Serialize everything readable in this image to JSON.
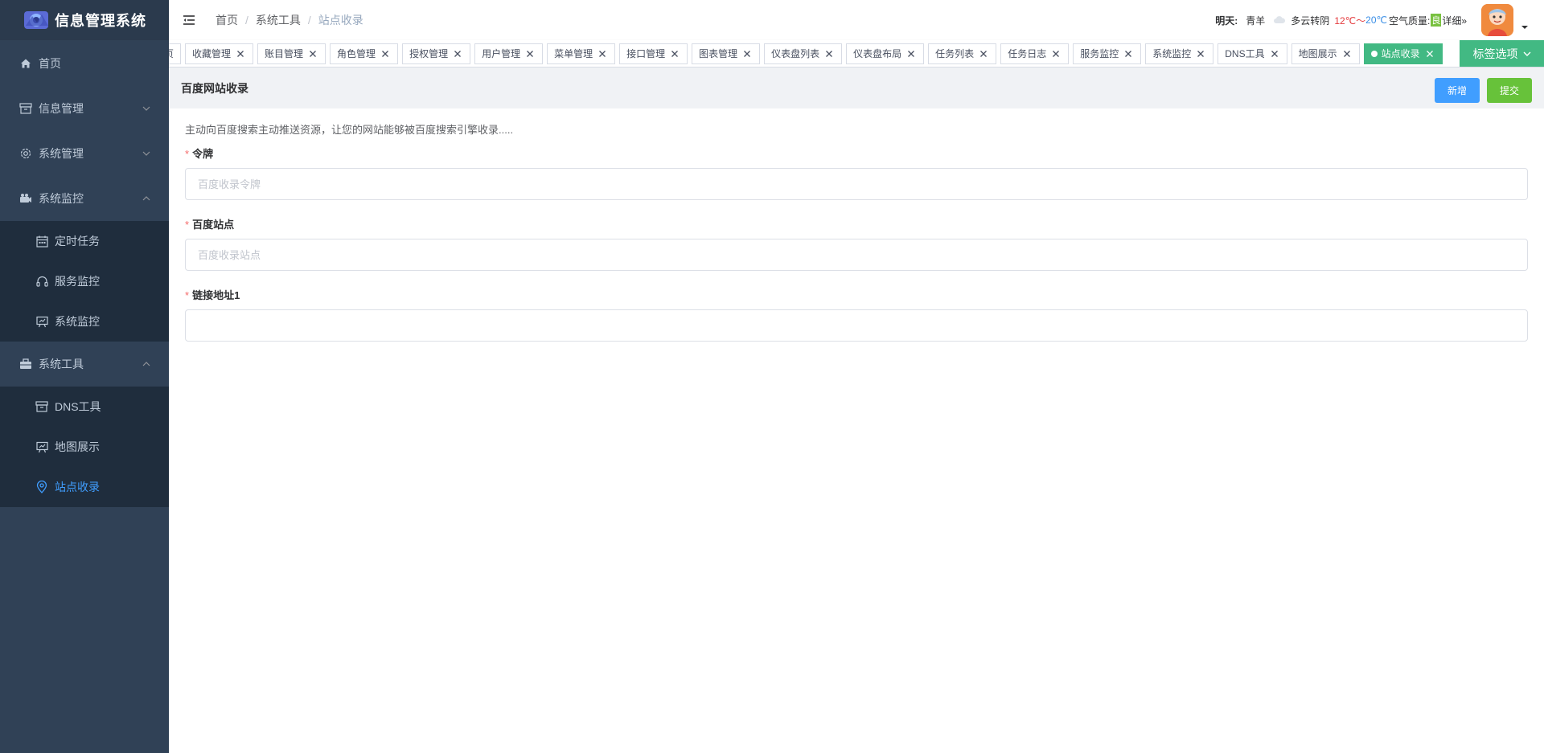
{
  "app": {
    "title": "信息管理系统"
  },
  "sidebar": {
    "items": [
      {
        "label": "首页",
        "icon": "home-icon"
      },
      {
        "label": "信息管理",
        "icon": "archive-icon",
        "expanded": false
      },
      {
        "label": "系统管理",
        "icon": "gear-icon",
        "expanded": false
      },
      {
        "label": "系统监控",
        "icon": "camera-icon",
        "expanded": true,
        "children": [
          {
            "label": "定时任务",
            "icon": "calendar-icon"
          },
          {
            "label": "服务监控",
            "icon": "headset-icon"
          },
          {
            "label": "系统监控",
            "icon": "monitor-icon"
          }
        ]
      },
      {
        "label": "系统工具",
        "icon": "toolbox-icon",
        "expanded": true,
        "children": [
          {
            "label": "DNS工具",
            "icon": "archive-icon"
          },
          {
            "label": "地图展示",
            "icon": "monitor-icon"
          },
          {
            "label": "站点收录",
            "icon": "location-icon",
            "active": true
          }
        ]
      }
    ]
  },
  "header": {
    "breadcrumb": [
      "首页",
      "系统工具",
      "站点收录"
    ],
    "weather": {
      "label": "明天:",
      "city": "青羊",
      "condition": "多云转阴",
      "high": "12℃～",
      "low": "20℃",
      "air_label": "空气质量:",
      "air_value": "良",
      "detail": "详细»"
    }
  },
  "tags": {
    "items": [
      "页",
      "收藏管理",
      "账目管理",
      "角色管理",
      "授权管理",
      "用户管理",
      "菜单管理",
      "接口管理",
      "图表管理",
      "仪表盘列表",
      "仪表盘布局",
      "任务列表",
      "任务日志",
      "服务监控",
      "系统监控",
      "DNS工具",
      "地图展示",
      "站点收录"
    ],
    "active": "站点收录",
    "options_label": "标签选项"
  },
  "page": {
    "title": "百度网站收录",
    "add_label": "新增",
    "submit_label": "提交",
    "description": "主动向百度搜索主动推送资源，让您的网站能够被百度搜索引擎收录.....",
    "fields": [
      {
        "label": "令牌",
        "placeholder": "百度收录令牌",
        "value": ""
      },
      {
        "label": "百度站点",
        "placeholder": "百度收录站点",
        "value": ""
      },
      {
        "label": "链接地址1",
        "placeholder": "",
        "value": ""
      }
    ]
  },
  "colors": {
    "sidebar_bg": "#304156",
    "submenu_bg": "#1f2d3d",
    "active_menu": "#409eff",
    "tag_active": "#42b983",
    "btn_primary": "#409eff",
    "btn_success": "#67c23a"
  }
}
